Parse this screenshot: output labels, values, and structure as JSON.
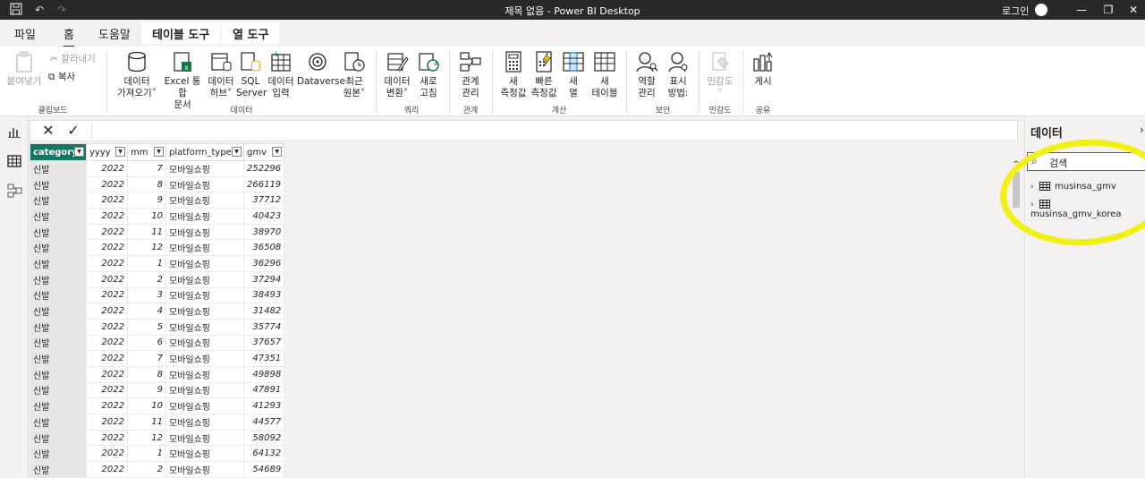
{
  "window": {
    "title": "제목 없음 - Power BI Desktop",
    "login": "로그인"
  },
  "ribbon_tabs": [
    {
      "label": "파일"
    },
    {
      "label": "홈"
    },
    {
      "label": "도움말"
    },
    {
      "label": "테이블 도구"
    },
    {
      "label": "열 도구"
    }
  ],
  "ribbon": {
    "clipboard": {
      "paste": "붙여넣기",
      "cut": "잘라내기",
      "copy": "복사",
      "group": "클립보드"
    },
    "data": {
      "get_data_1": "데이터",
      "get_data_2": "가져오기",
      "excel_1": "Excel 통합",
      "excel_2": "문서",
      "hub_1": "데이터",
      "hub_2": "허브",
      "sql_1": "SQL",
      "sql_2": "Server",
      "enter_1": "데이터",
      "enter_2": "입력",
      "dataverse": "Dataverse",
      "recent_1": "최근",
      "recent_2": "원본",
      "group": "데이터"
    },
    "query": {
      "transform_1": "데이터",
      "transform_2": "변환",
      "refresh_1": "새로",
      "refresh_2": "고침",
      "group": "쿼리"
    },
    "relations": {
      "manage_1": "관계",
      "manage_2": "관리",
      "group": "관계"
    },
    "calc": {
      "measure_1": "새",
      "measure_2": "측정값",
      "quick_1": "빠른",
      "quick_2": "측정값",
      "column_1": "새",
      "column_2": "열",
      "table_1": "새",
      "table_2": "테이블",
      "group": "계산"
    },
    "security": {
      "roles_1": "역할",
      "roles_2": "관리",
      "view_1": "표시",
      "view_2": "방법:",
      "group": "보안"
    },
    "sensitivity": {
      "label": "민감도",
      "group": "민감도"
    },
    "share": {
      "publish": "게시",
      "group": "공유"
    }
  },
  "table": {
    "columns": [
      "category",
      "yyyy",
      "mm",
      "platform_type",
      "gmv"
    ],
    "rows": [
      [
        "신발",
        "2022",
        "7",
        "모바일쇼핑",
        "252296"
      ],
      [
        "신발",
        "2022",
        "8",
        "모바일쇼핑",
        "266119"
      ],
      [
        "신발",
        "2022",
        "9",
        "모바일쇼핑",
        "37712"
      ],
      [
        "신발",
        "2022",
        "10",
        "모바일쇼핑",
        "40423"
      ],
      [
        "신발",
        "2022",
        "11",
        "모바일쇼핑",
        "38970"
      ],
      [
        "신발",
        "2022",
        "12",
        "모바일쇼핑",
        "36508"
      ],
      [
        "신발",
        "2022",
        "1",
        "모바일쇼핑",
        "36296"
      ],
      [
        "신발",
        "2022",
        "2",
        "모바일쇼핑",
        "37294"
      ],
      [
        "신발",
        "2022",
        "3",
        "모바일쇼핑",
        "38493"
      ],
      [
        "신발",
        "2022",
        "4",
        "모바일쇼핑",
        "31482"
      ],
      [
        "신발",
        "2022",
        "5",
        "모바일쇼핑",
        "35774"
      ],
      [
        "신발",
        "2022",
        "6",
        "모바일쇼핑",
        "37657"
      ],
      [
        "신발",
        "2022",
        "7",
        "모바일쇼핑",
        "47351"
      ],
      [
        "신발",
        "2022",
        "8",
        "모바일쇼핑",
        "49898"
      ],
      [
        "신발",
        "2022",
        "9",
        "모바일쇼핑",
        "47891"
      ],
      [
        "신발",
        "2022",
        "10",
        "모바일쇼핑",
        "41293"
      ],
      [
        "신발",
        "2022",
        "11",
        "모바일쇼핑",
        "44577"
      ],
      [
        "신발",
        "2022",
        "12",
        "모바일쇼핑",
        "58092"
      ],
      [
        "신발",
        "2022",
        "1",
        "모바일쇼핑",
        "64132"
      ],
      [
        "신발",
        "2022",
        "2",
        "모바일쇼핑",
        "54689"
      ]
    ]
  },
  "data_pane": {
    "title": "데이터",
    "search_placeholder": "검색",
    "tables": [
      "musinsa_gmv",
      "musinsa_gmv_korea"
    ]
  },
  "colors": {
    "selected_header": "#117865",
    "highlight": "#f0f014",
    "titlebar": "#292929"
  }
}
